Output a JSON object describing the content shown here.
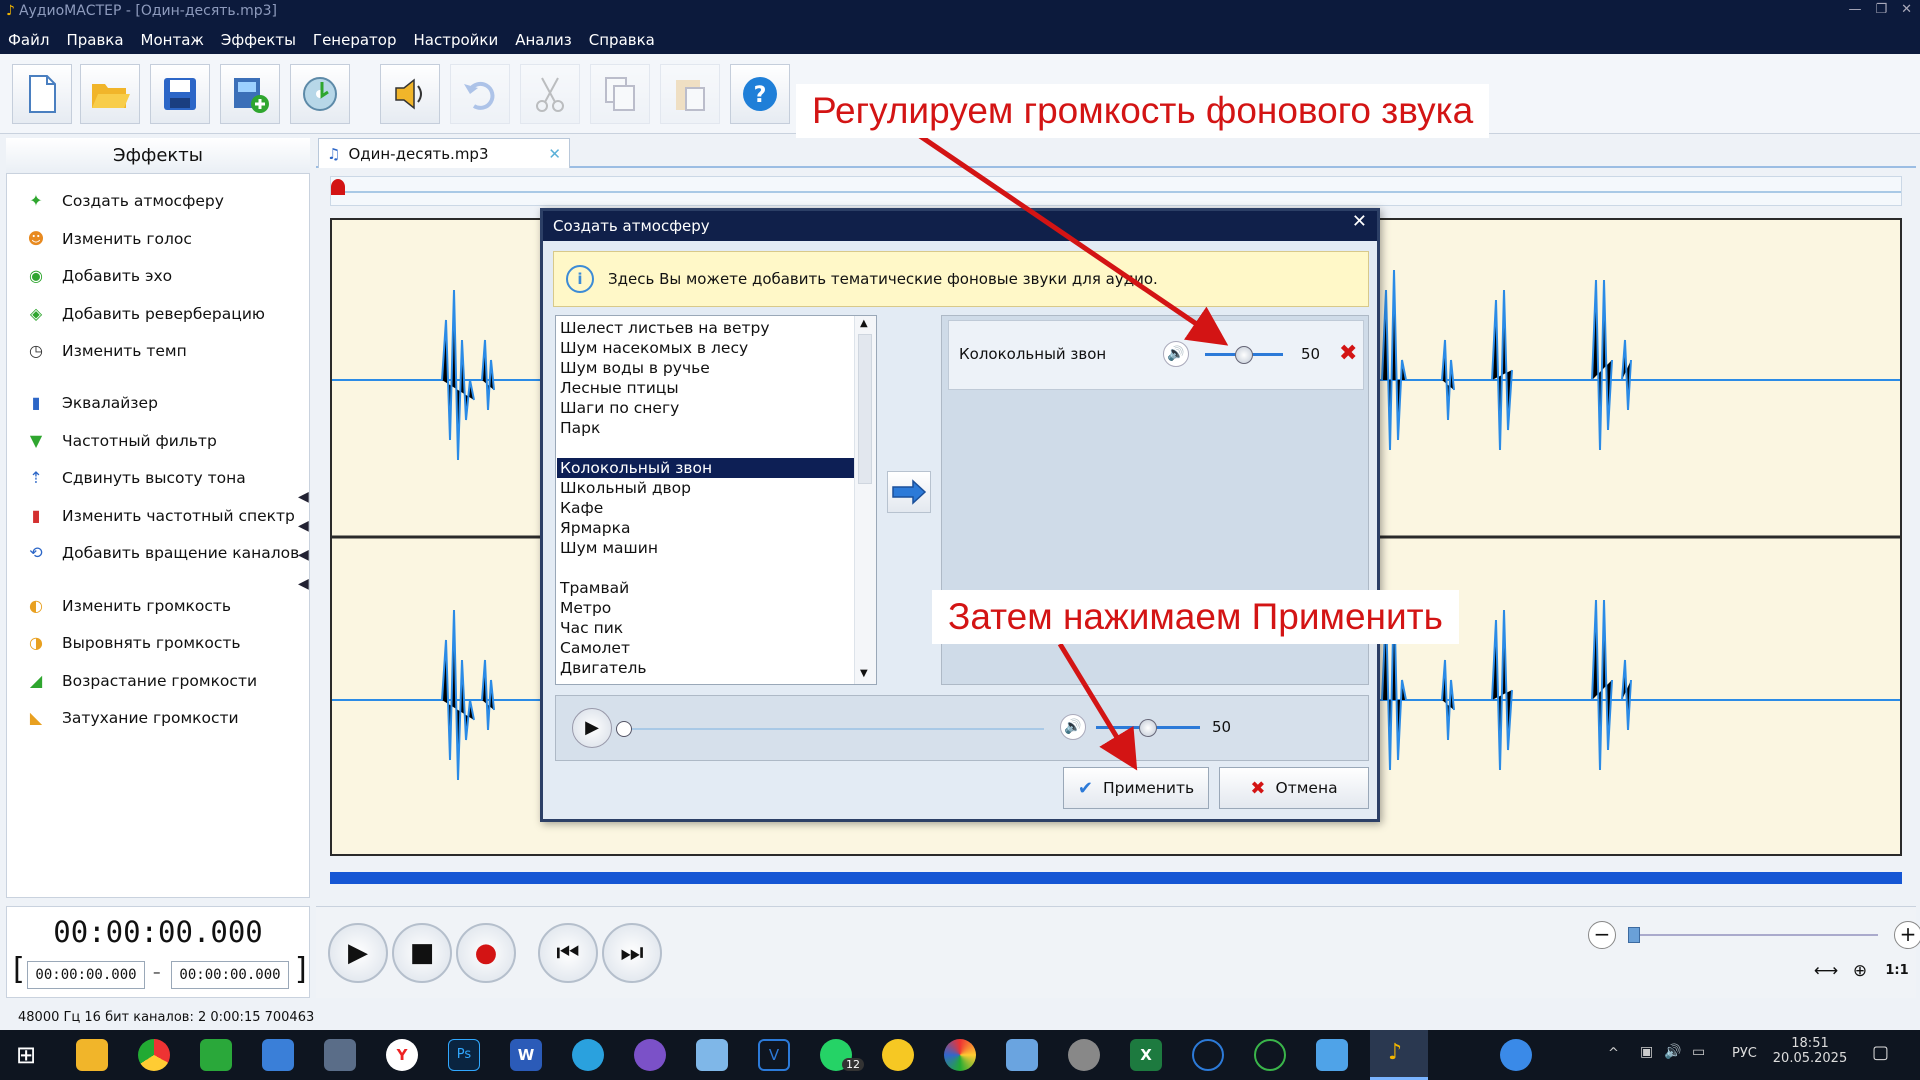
{
  "window": {
    "title": "АудиоМАСТЕР - [Один-десять.mp3]"
  },
  "menu": [
    "Файл",
    "Правка",
    "Монтаж",
    "Эффекты",
    "Генератор",
    "Настройки",
    "Анализ",
    "Справка"
  ],
  "toolbar": {
    "icons": [
      "new-file-icon",
      "open-folder-icon",
      "save-icon",
      "add-video-icon",
      "cd-import-icon",
      "record-voice-icon",
      "undo-icon",
      "cut-icon",
      "copy-icon",
      "paste-icon",
      "help-icon"
    ]
  },
  "effects_panel": {
    "title": "Эффекты",
    "items": [
      "Создать атмосферу",
      "Изменить голос",
      "Добавить эхо",
      "Добавить реверберацию",
      "Изменить темп",
      "Эквалайзер",
      "Частотный фильтр",
      "Сдвинуть высоту тона",
      "Изменить частотный спектр",
      "Добавить вращение каналов",
      "Изменить громкость",
      "Выровнять громкость",
      "Возрастание громкости",
      "Затухание громкости"
    ]
  },
  "tab": {
    "label": "Один-десять.mp3"
  },
  "dialog": {
    "title": "Создать атмосферу",
    "info": "Здесь Вы можете добавить тематические фоновые звуки для аудио.",
    "sounds": [
      "Шелест листьев на ветру",
      "Шум насекомых в лесу",
      "Шум воды в ручье",
      "Лесные птицы",
      "Шаги по снегу",
      "Парк",
      "",
      "Колокольный звон",
      "Школьный двор",
      "Кафе",
      "Ярмарка",
      "Шум машин",
      "",
      "Трамвай",
      "Метро",
      "Час пик",
      "Самолет",
      "Двигатель"
    ],
    "selected": "Колокольный звон",
    "added_sound": {
      "name": "Колокольный звон",
      "volume": "50",
      "volume_level": 0.5
    },
    "preview": {
      "volume": "50",
      "volume_level": 0.5,
      "position": 0
    },
    "apply_label": "Применить",
    "cancel_label": "Отмена"
  },
  "annotations": {
    "top": "Регулируем громкость фонового звука",
    "bottom": "Затем нажимаем Применить"
  },
  "timer": {
    "current": "00:00:00.000",
    "start": "00:00:00.000",
    "end": "00:00:00.000"
  },
  "status": "48000 Гц  16 бит  каналов: 2   0:00:15 700463",
  "zoom": {
    "labels": [
      "⟷",
      "⊕",
      "1:1"
    ]
  },
  "tray": {
    "lang": "РУС",
    "time": "18:51",
    "date": "20.05.2025",
    "badge": "12"
  },
  "colors": {
    "accent": "#1556d4",
    "waveform": "#2b8be6",
    "annotation": "#d31414"
  }
}
